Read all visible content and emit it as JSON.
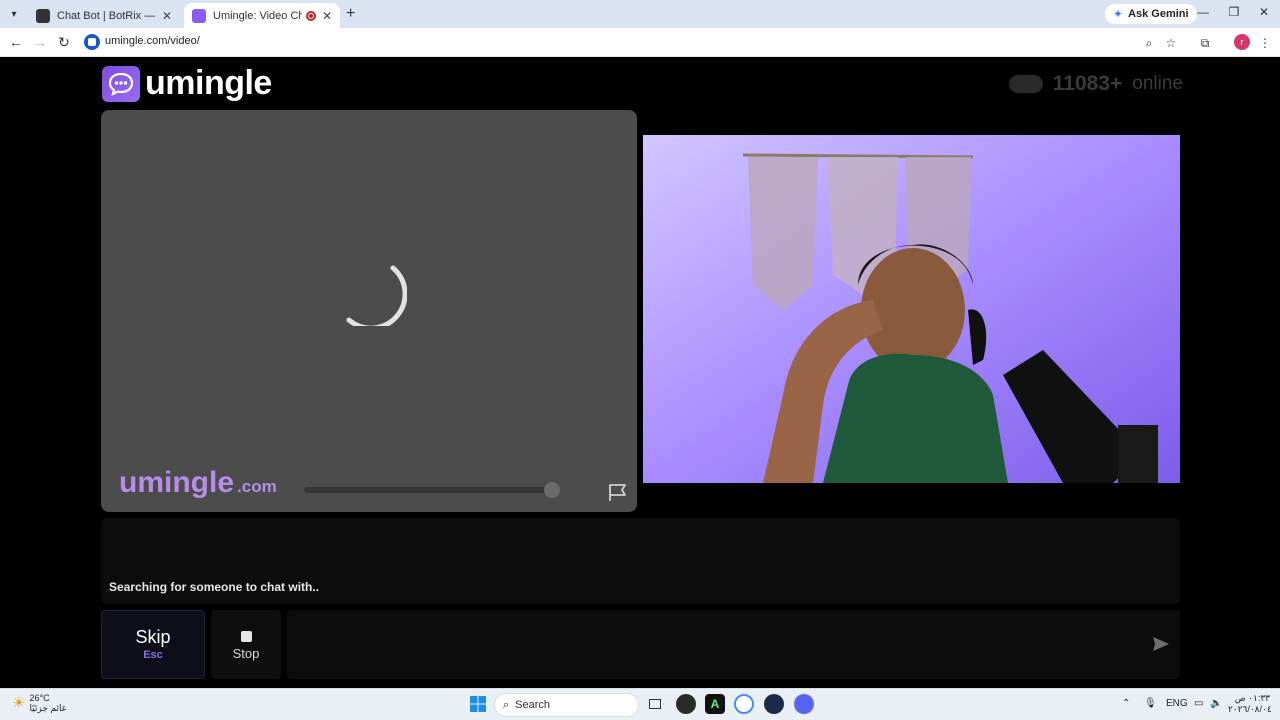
{
  "browser": {
    "tabs": [
      {
        "title": "Chat Bot | BotRix — Cloud Stream",
        "active": false
      },
      {
        "title": "Umingle: Video Chat with Strangers",
        "active": true
      }
    ],
    "new_tab": "+",
    "ask_gemini": "Ask Gemini",
    "url": "umingle.com/video/",
    "profile_initial": "r"
  },
  "header": {
    "logo_text": "umingle",
    "online_count": "11083+",
    "online_label": "online"
  },
  "stranger_video": {
    "watermark": "umingle",
    "watermark_domain": ".com",
    "loading": true
  },
  "chat": {
    "status_text": "Searching for someone to chat with.."
  },
  "controls": {
    "skip_label": "Skip",
    "skip_shortcut": "Esc",
    "stop_label": "Stop",
    "message_placeholder": ""
  },
  "taskbar": {
    "weather_temp": "26°C",
    "weather_condition": "غائم جزئيًا",
    "search_label": "Search",
    "language": "ENG",
    "time": "٠١:٣٣ ص",
    "date": "٢٠٢٦/٠٨/٠٤"
  },
  "colors": {
    "brand": "#8b5cf6",
    "tab_active": "#ffffff",
    "tabstrip": "#d9e3f2"
  }
}
